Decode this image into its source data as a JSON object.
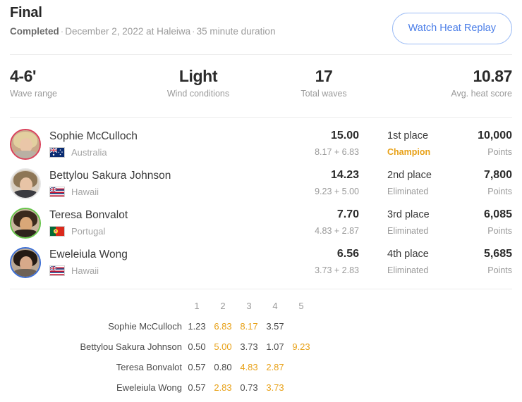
{
  "header": {
    "title": "Final",
    "status": "Completed",
    "meta": "December 2, 2022 at Haleiwa",
    "duration": "35 minute duration",
    "separator": "·",
    "replay_label": "Watch Heat Replay"
  },
  "stats": [
    {
      "value": "4-6'",
      "label": "Wave range"
    },
    {
      "value": "Light",
      "label": "Wind conditions"
    },
    {
      "value": "17",
      "label": "Total waves"
    },
    {
      "value": "10.87",
      "label": "Avg. heat score"
    }
  ],
  "athletes": [
    {
      "name": "Sophie McCulloch",
      "country": "Australia",
      "flag": "australia-flag",
      "score": "15.00",
      "score_sum": "8.17 + 6.83",
      "place": "1st place",
      "status": "Champion",
      "champion": true,
      "points": "10,000",
      "points_label": "Points",
      "ring_color": "#d9415a"
    },
    {
      "name": "Bettylou Sakura Johnson",
      "country": "Hawaii",
      "flag": "hawaii-flag",
      "score": "14.23",
      "score_sum": "9.23 + 5.00",
      "place": "2nd place",
      "status": "Eliminated",
      "champion": false,
      "points": "7,800",
      "points_label": "Points",
      "ring_color": "#e6e6e6"
    },
    {
      "name": "Teresa Bonvalot",
      "country": "Portugal",
      "flag": "portugal-flag",
      "score": "7.70",
      "score_sum": "4.83 + 2.87",
      "place": "3rd place",
      "status": "Eliminated",
      "champion": false,
      "points": "6,085",
      "points_label": "Points",
      "ring_color": "#66c44a"
    },
    {
      "name": "Eweleiula Wong",
      "country": "Hawaii",
      "flag": "hawaii-flag",
      "score": "6.56",
      "score_sum": "3.73 + 2.83",
      "place": "4th place",
      "status": "Eliminated",
      "champion": false,
      "points": "5,685",
      "points_label": "Points",
      "ring_color": "#3d6fd4"
    }
  ],
  "wave_table": {
    "columns": [
      "1",
      "2",
      "3",
      "4",
      "5"
    ],
    "rows": [
      {
        "name": "Sophie McCulloch",
        "waves": [
          {
            "value": "1.23",
            "counted": false
          },
          {
            "value": "6.83",
            "counted": true
          },
          {
            "value": "8.17",
            "counted": true
          },
          {
            "value": "3.57",
            "counted": false
          },
          {
            "value": "",
            "counted": false
          }
        ]
      },
      {
        "name": "Bettylou Sakura Johnson",
        "waves": [
          {
            "value": "0.50",
            "counted": false
          },
          {
            "value": "5.00",
            "counted": true
          },
          {
            "value": "3.73",
            "counted": false
          },
          {
            "value": "1.07",
            "counted": false
          },
          {
            "value": "9.23",
            "counted": true
          }
        ]
      },
      {
        "name": "Teresa Bonvalot",
        "waves": [
          {
            "value": "0.57",
            "counted": false
          },
          {
            "value": "0.80",
            "counted": false
          },
          {
            "value": "4.83",
            "counted": true
          },
          {
            "value": "2.87",
            "counted": true
          },
          {
            "value": "",
            "counted": false
          }
        ]
      },
      {
        "name": "Eweleiula Wong",
        "waves": [
          {
            "value": "0.57",
            "counted": false
          },
          {
            "value": "2.83",
            "counted": true
          },
          {
            "value": "0.73",
            "counted": false
          },
          {
            "value": "3.73",
            "counted": true
          },
          {
            "value": "",
            "counted": false
          }
        ]
      }
    ]
  },
  "colors": {
    "champion_orange": "#e8a117",
    "link_blue": "#4b7ee8",
    "text_dark": "#2b2b2b",
    "text_muted": "#9a9a9a"
  }
}
